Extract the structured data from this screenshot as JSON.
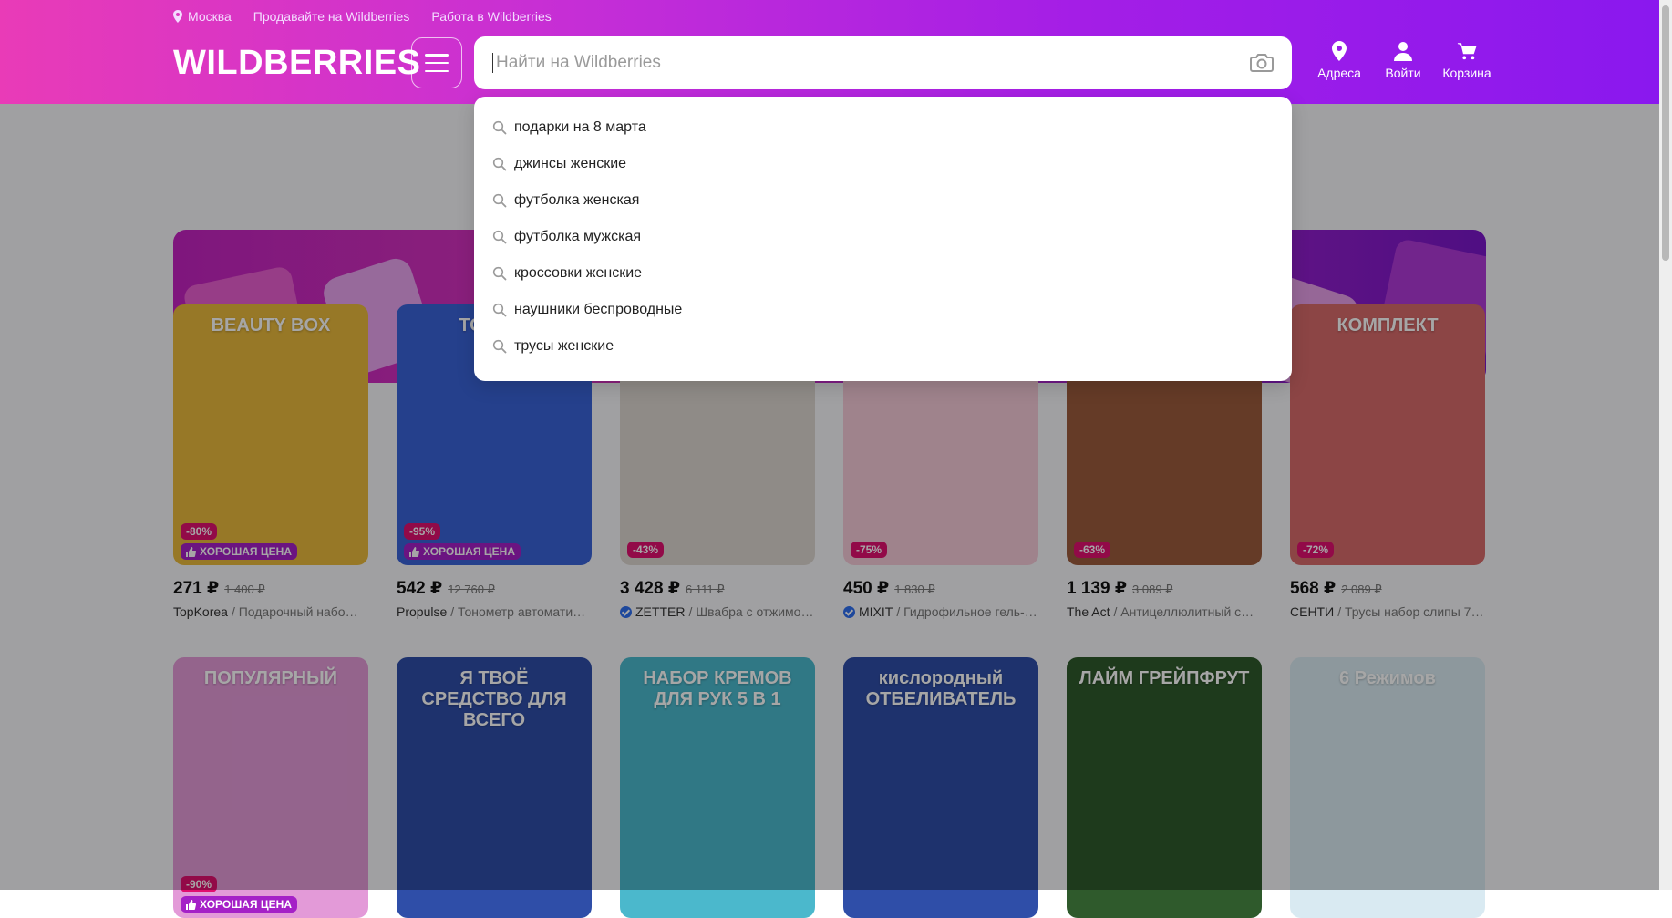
{
  "topbar": {
    "location": "Москва",
    "sell": "Продавайте на Wildberries",
    "work": "Работа в Wildberries"
  },
  "logo": "WILDBERRIES",
  "search": {
    "placeholder": "Найти на Wildberries",
    "value": ""
  },
  "actions": [
    {
      "label": "Адреса",
      "icon": "map-pin-icon"
    },
    {
      "label": "Войти",
      "icon": "user-icon"
    },
    {
      "label": "Корзина",
      "icon": "cart-icon"
    }
  ],
  "suggestions": [
    "подарки на 8 марта",
    "джинсы женские",
    "футболка женская",
    "футболка мужская",
    "кроссовки женские",
    "наушники беспроводные",
    "трусы женские"
  ],
  "good_price_label": "ХОРОШАЯ ЦЕНА",
  "products_row1": [
    {
      "headline": "BEAUTY BOX",
      "discount": "-80%",
      "good_price": true,
      "price": "271 ₽",
      "old_price": "1 400 ₽",
      "brand": "TopKorea",
      "name": " / Подарочный набо…",
      "verified": false,
      "color": "#e8b83c"
    },
    {
      "headline": "ТОНО…",
      "discount": "-95%",
      "good_price": true,
      "price": "542 ₽",
      "old_price": "12 760 ₽",
      "brand": "Propulse",
      "name": " / Тонометр автомати…",
      "verified": false,
      "color": "#3a63d8"
    },
    {
      "headline": "",
      "discount": "-43%",
      "good_price": false,
      "price": "3 428 ₽",
      "old_price": "6 111 ₽",
      "brand": "ZETTER",
      "name": " / Швабра с отжимо…",
      "verified": true,
      "color": "#dcd6d0"
    },
    {
      "headline": "",
      "discount": "-75%",
      "good_price": false,
      "price": "450 ₽",
      "old_price": "1 830 ₽",
      "brand": "MIXIT",
      "name": " / Гидрофильное гель-…",
      "verified": true,
      "color": "#f4c9d8"
    },
    {
      "headline": "",
      "discount": "-63%",
      "good_price": false,
      "price": "1 139 ₽",
      "old_price": "3 089 ₽",
      "brand": "The Act",
      "name": " / Антицеллюлитный с…",
      "verified": false,
      "color": "#9b5b3c"
    },
    {
      "headline": "КОМПЛЕКТ",
      "discount": "-72%",
      "good_price": false,
      "price": "568 ₽",
      "old_price": "2 089 ₽",
      "brand": "СЕНТИ",
      "name": " / Трусы набор слипы 7шт",
      "verified": false,
      "color": "#d76a6a"
    }
  ],
  "products_row2": [
    {
      "headline": "ПОПУЛЯРНЫЙ",
      "discount": "-90%",
      "good_price": true,
      "color": "#e39ad8"
    },
    {
      "headline": "Я ТВОЁ СРЕДСТВО ДЛЯ ВСЕГО",
      "discount": "",
      "good_price": false,
      "color": "#2f4ea8"
    },
    {
      "headline": "НАБОР КРЕМОВ ДЛЯ РУК 5 В 1",
      "discount": "",
      "good_price": false,
      "color": "#4bb8cc"
    },
    {
      "headline": "кислородный ОТБЕЛИВАТЕЛЬ",
      "discount": "",
      "good_price": false,
      "color": "#2f4ea8"
    },
    {
      "headline": "ЛАЙМ ГРЕЙПФРУТ",
      "discount": "",
      "good_price": false,
      "color": "#2f5a2c"
    },
    {
      "headline": "6 Режимов",
      "discount": "",
      "good_price": false,
      "color": "#d9eaf2"
    }
  ],
  "colors": {
    "header_start": "#e93bb7",
    "header_end": "#8a18ee",
    "discount": "#e0106f",
    "good_price": "#a520c7"
  }
}
